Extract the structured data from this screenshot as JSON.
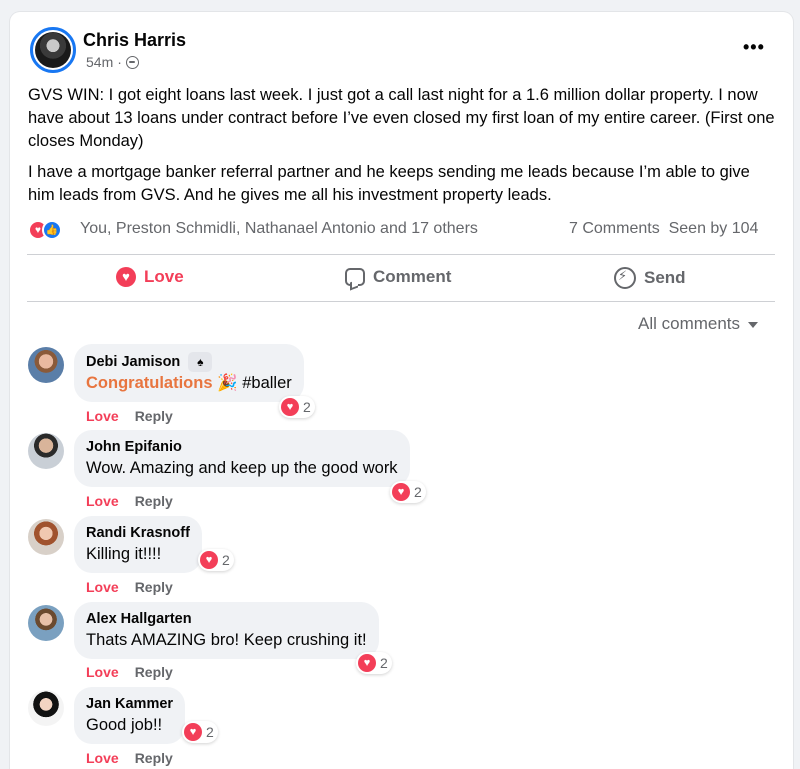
{
  "post": {
    "author": "Chris Harris",
    "time": "54m",
    "separator": "·",
    "menu_glyph": "•••",
    "paragraph1": "GVS WIN: I got eight loans last week. I just got a call last night for a 1.6 million dollar property. I now have about 13 loans under contract before I’ve even closed my first loan of my entire career.  (First one closes Monday)",
    "paragraph2": "I have a mortgage banker referral partner and he keeps sending me leads because I’m able to give him leads from GVS.  And he gives me all his investment property leads.",
    "reactors": "You, Preston Schmidli, Nathanael Antonio and 17 others",
    "comments_count": "7 Comments",
    "seen_by": "Seen by 104"
  },
  "actions": {
    "love": "Love",
    "comment": "Comment",
    "send": "Send"
  },
  "filter": {
    "label": "All comments"
  },
  "comment_ui": {
    "love": "Love",
    "reply": "Reply"
  },
  "comments": [
    {
      "name": "Debi Jamison",
      "highlight": "Congratulations",
      "emoji": "🎉",
      "text": " #baller",
      "reactions": "2",
      "badge": "♠"
    },
    {
      "name": "John Epifanio",
      "text": "Wow. Amazing and keep up the good work",
      "reactions": "2"
    },
    {
      "name": "Randi Krasnoff",
      "text": "Killing it!!!!",
      "reactions": "2"
    },
    {
      "name": "Alex Hallgarten",
      "text": "Thats AMAZING bro! Keep crushing it!",
      "reactions": "2"
    },
    {
      "name": "Jan Kammer",
      "text": "Good job!!",
      "reactions": "2"
    }
  ],
  "colors": {
    "love_red": "#f33e58",
    "like_blue": "#1877f2",
    "highlight_orange": "#e8753f",
    "muted": "#65676b"
  }
}
